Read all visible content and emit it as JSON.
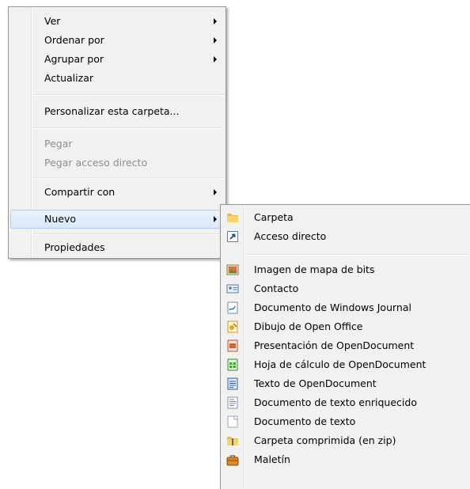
{
  "context_menu": {
    "items": [
      {
        "label": "Ver"
      },
      {
        "label": "Ordenar por"
      },
      {
        "label": "Agrupar por"
      },
      {
        "label": "Actualizar"
      },
      {
        "label": "Personalizar esta carpeta..."
      },
      {
        "label": "Pegar",
        "disabled": true
      },
      {
        "label": "Pegar acceso directo",
        "disabled": true
      },
      {
        "label": "Compartir con"
      },
      {
        "label": "Nuevo",
        "highlighted": true
      },
      {
        "label": "Propiedades"
      }
    ]
  },
  "new_submenu": {
    "items": [
      {
        "label": "Carpeta",
        "icon": "folder-icon"
      },
      {
        "label": "Acceso directo",
        "icon": "shortcut-icon"
      },
      {
        "label": "Imagen de mapa de bits",
        "icon": "bitmap-icon"
      },
      {
        "label": "Contacto",
        "icon": "contact-icon"
      },
      {
        "label": "Documento de Windows Journal",
        "icon": "journal-icon"
      },
      {
        "label": "Dibujo de Open Office",
        "icon": "openoffice-draw-icon"
      },
      {
        "label": "Presentación de OpenDocument",
        "icon": "odp-presentation-icon"
      },
      {
        "label": "Hoja de cálculo de OpenDocument",
        "icon": "ods-spreadsheet-icon"
      },
      {
        "label": "Texto de OpenDocument",
        "icon": "odt-text-icon"
      },
      {
        "label": "Documento de texto enriquecido",
        "icon": "rtf-document-icon"
      },
      {
        "label": "Documento de texto",
        "icon": "text-document-icon"
      },
      {
        "label": "Carpeta comprimida (en zip)",
        "icon": "zip-folder-icon"
      },
      {
        "label": "Maletín",
        "icon": "briefcase-icon"
      }
    ]
  },
  "colors": {
    "menu_background": "#f1f1f1",
    "highlight": "#d9e9fb",
    "disabled_text": "#8d8d8d"
  }
}
